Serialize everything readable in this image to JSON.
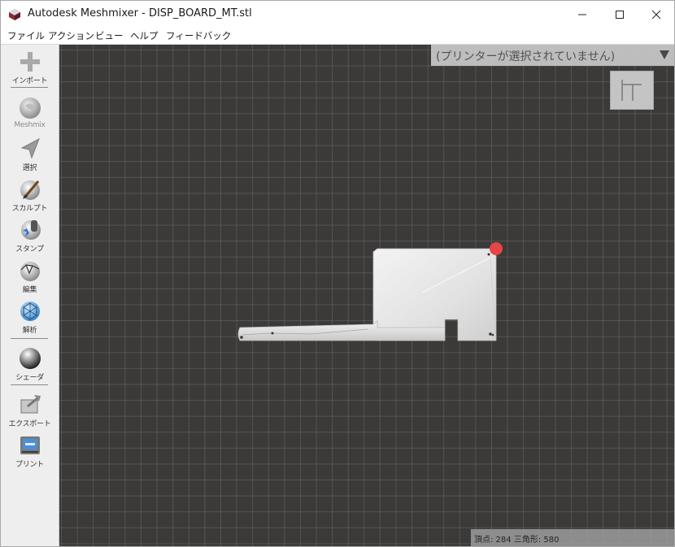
{
  "window": {
    "title": "Autodesk Meshmixer - DISP_BOARD_MT.stl"
  },
  "menu": [
    "ファイル",
    "アクション",
    "ビュー",
    "ヘルプ",
    "フィードバック"
  ],
  "sidebar": {
    "tools": [
      {
        "label": "インポート",
        "icon": "plus-icon"
      },
      {
        "label": "Meshmix",
        "icon": "meshmix-icon"
      },
      {
        "label": "選択",
        "icon": "select-arrow-icon"
      },
      {
        "label": "スカルプト",
        "icon": "sculpt-brush-icon"
      },
      {
        "label": "スタンプ",
        "icon": "stamp-icon"
      },
      {
        "label": "編集",
        "icon": "edit-icon"
      },
      {
        "label": "解析",
        "icon": "analysis-icon"
      },
      {
        "label": "シェーダ",
        "icon": "shader-sphere-icon"
      },
      {
        "label": "エクスポート",
        "icon": "export-icon"
      },
      {
        "label": "プリント",
        "icon": "print-icon"
      }
    ]
  },
  "printer": {
    "label": "(プリンターが選択されていません)"
  },
  "status": {
    "text": "頂点: 284 三角形: 580"
  },
  "colors": {
    "viewport_bg": "#3b3a39",
    "grid": "#6e6e6e",
    "model": "#e6e6e6",
    "marker": "#e84545"
  }
}
